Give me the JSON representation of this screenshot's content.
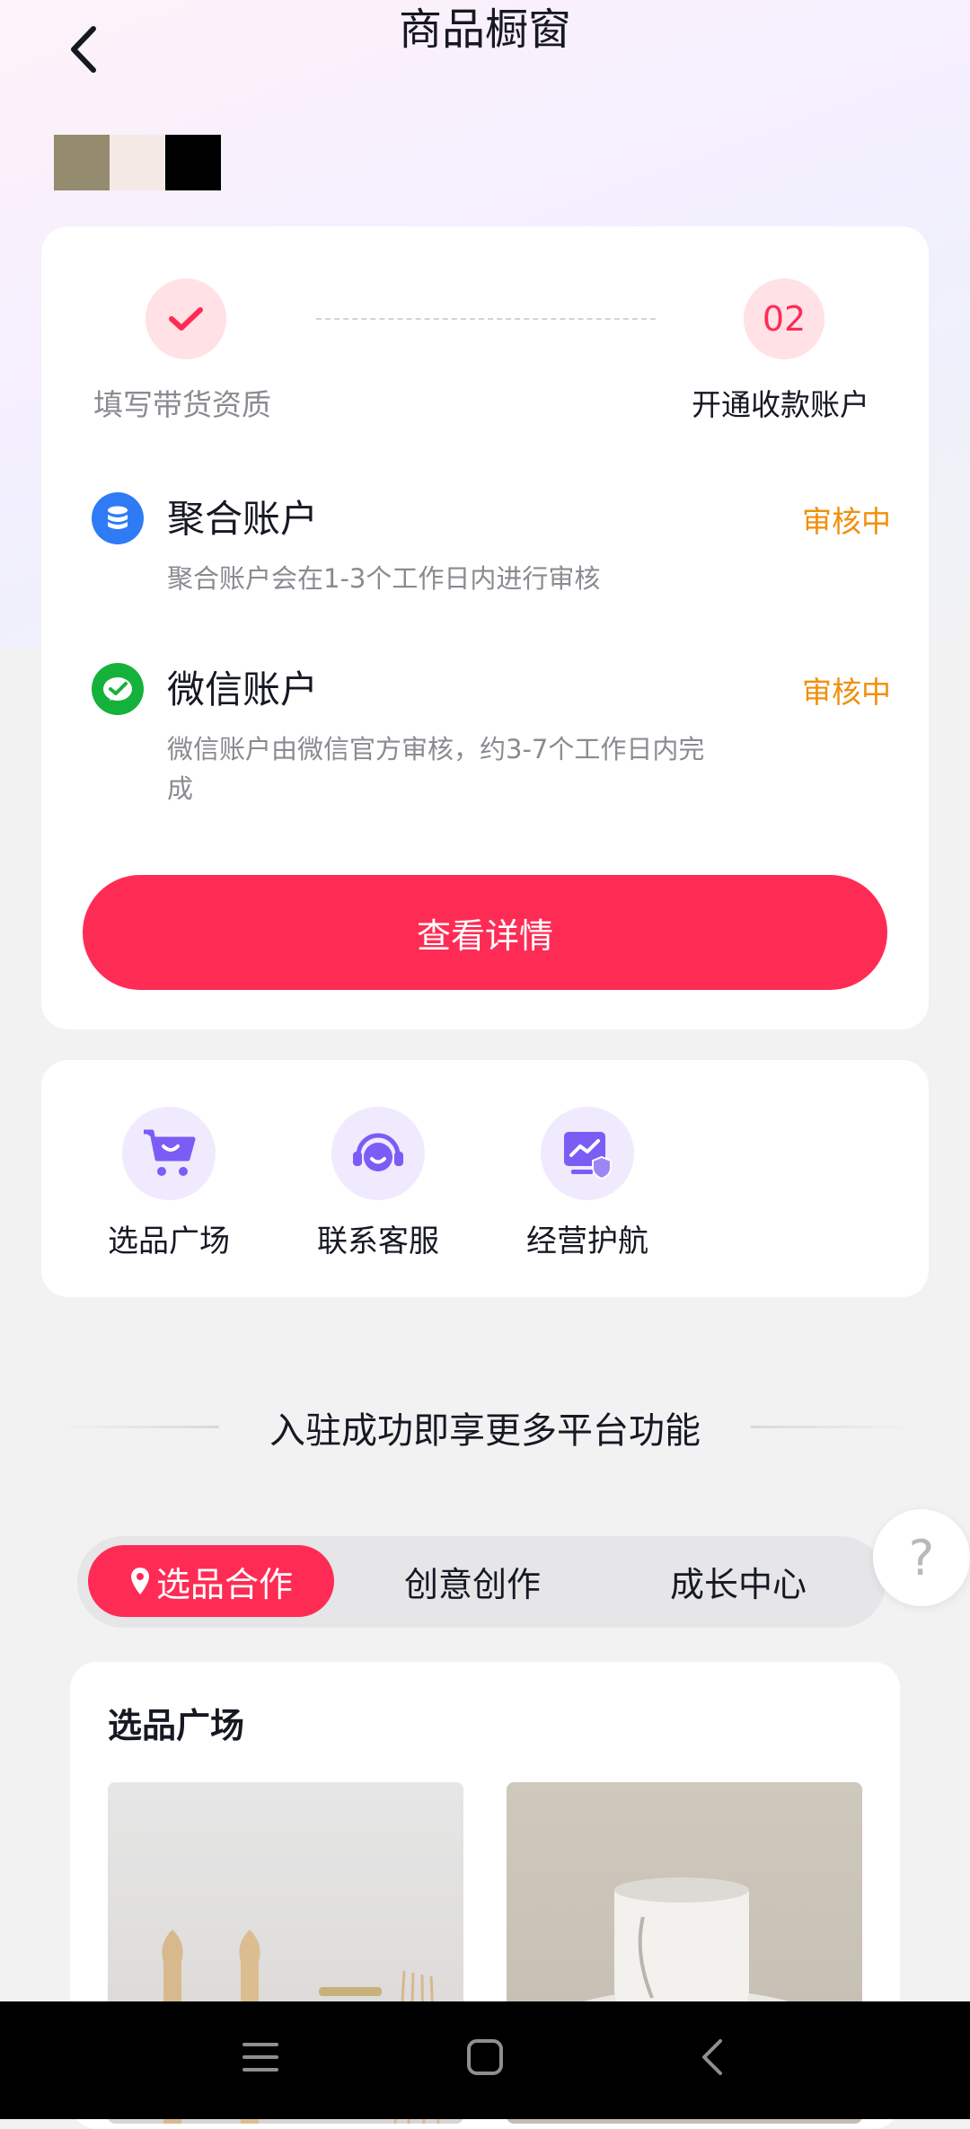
{
  "header": {
    "title": "商品橱窗"
  },
  "profile": {
    "swatch_colors": [
      "#958b6e",
      "#f4e9e4",
      "#000000"
    ]
  },
  "progress": {
    "steps": [
      {
        "label": "填写带货资质",
        "state": "done"
      },
      {
        "number": "02",
        "label": "开通收款账户",
        "state": "current"
      }
    ]
  },
  "accounts": [
    {
      "icon": "coin-stack-icon",
      "color": "#2f7bf6",
      "title": "聚合账户",
      "status": "审核中",
      "desc": "聚合账户会在1-3个工作日内进行审核"
    },
    {
      "icon": "wechat-pay-icon",
      "color": "#14b23a",
      "title": "微信账户",
      "status": "审核中",
      "desc_line1": "微信账户由微信官方审核，约3-7个工作日内完",
      "desc_line2": "成"
    }
  ],
  "details_button": {
    "label": "查看详情"
  },
  "quick_actions": [
    {
      "icon": "shopping-cart-icon",
      "label": "选品广场"
    },
    {
      "icon": "headset-icon",
      "label": "联系客服"
    },
    {
      "icon": "shield-chart-icon",
      "label": "经营护航"
    }
  ],
  "features": {
    "heading": "入驻成功即享更多平台功能",
    "tabs": [
      {
        "label": "选品合作",
        "active": true,
        "icon": "location-pin-icon"
      },
      {
        "label": "创意创作",
        "active": false
      },
      {
        "label": "成长中心",
        "active": false
      }
    ],
    "panel_title": "选品广场"
  },
  "help": {
    "label": "?"
  },
  "colors": {
    "accent": "#fe2c55",
    "status_pending": "#f0900c",
    "icon_purple": "#7b5cf5"
  }
}
